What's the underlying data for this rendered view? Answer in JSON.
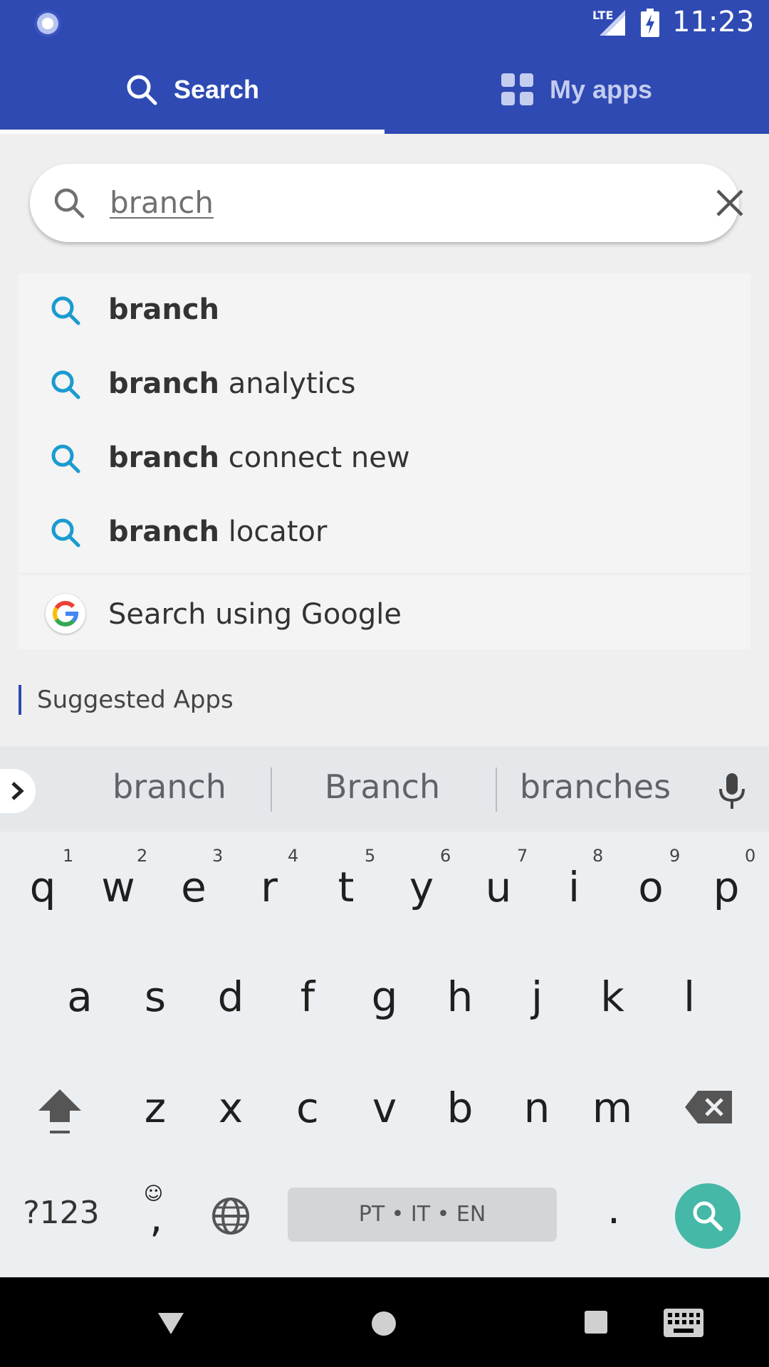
{
  "status_bar": {
    "network": "LTE",
    "time": "11:23"
  },
  "tabs": [
    {
      "label": "Search",
      "icon": "search-icon",
      "selected": true
    },
    {
      "label": "My apps",
      "icon": "grid-icon",
      "selected": false
    }
  ],
  "search": {
    "value": "branch"
  },
  "suggestions": [
    {
      "bold": "branch",
      "rest": ""
    },
    {
      "bold": "branch",
      "rest": " analytics"
    },
    {
      "bold": "branch",
      "rest": " connect new"
    },
    {
      "bold": "branch",
      "rest": " locator"
    }
  ],
  "google_search": {
    "label": "Search using Google"
  },
  "suggested_apps": {
    "heading": "Suggested Apps"
  },
  "keyboard": {
    "suggestions": [
      "branch",
      "Branch",
      "branches"
    ],
    "row1": [
      "q",
      "w",
      "e",
      "r",
      "t",
      "y",
      "u",
      "i",
      "o",
      "p"
    ],
    "row1_hints": [
      "1",
      "2",
      "3",
      "4",
      "5",
      "6",
      "7",
      "8",
      "9",
      "0"
    ],
    "row2": [
      "a",
      "s",
      "d",
      "f",
      "g",
      "h",
      "j",
      "k",
      "l"
    ],
    "row3": [
      "z",
      "x",
      "c",
      "v",
      "b",
      "n",
      "m"
    ],
    "symbols_label": "?123",
    "comma": ",",
    "period": ".",
    "space_label": "PT • IT • EN",
    "accent_color": "#45b8a8"
  },
  "colors": {
    "brand": "#2f4ab3",
    "suggestion_icon": "#1a9bd0"
  }
}
